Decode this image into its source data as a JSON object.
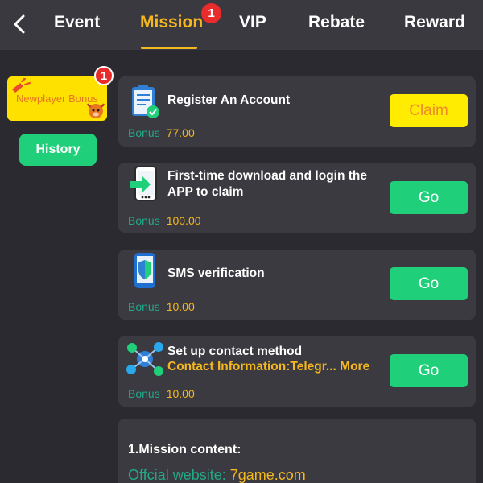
{
  "nav": {
    "tabs": [
      {
        "label": "Event"
      },
      {
        "label": "Mission",
        "badge": "1",
        "active": true
      },
      {
        "label": "VIP"
      },
      {
        "label": "Rebate"
      },
      {
        "label": "Reward"
      }
    ],
    "active_color": "#f5b71f"
  },
  "sidebar": {
    "newplayer_label": "Newplayer Bonus",
    "newplayer_badge": "1",
    "history_label": "History"
  },
  "tasks": [
    {
      "title": "Register An Account",
      "bonus_label": "Bonus",
      "bonus_value": "77.00",
      "action": "Claim",
      "icon": "clipboard-check-icon"
    },
    {
      "title": "First-time download and login the APP to claim",
      "bonus_label": "Bonus",
      "bonus_value": "100.00",
      "action": "Go",
      "icon": "phone-download-icon"
    },
    {
      "title": "SMS verification",
      "bonus_label": "Bonus",
      "bonus_value": "10.00",
      "action": "Go",
      "icon": "phone-shield-icon"
    },
    {
      "title": "Set up contact method",
      "subtitle": "Contact Information:Telegr...",
      "more": "More",
      "bonus_label": "Bonus",
      "bonus_value": "10.00",
      "action": "Go",
      "icon": "social-network-icon"
    }
  ],
  "mission_content": {
    "title": "1.Mission content:",
    "website_label": "Offcial website: ",
    "website_value": "7game.com"
  },
  "colors": {
    "background": "#2b2a30",
    "card": "#3b3a40",
    "green": "#1fcf7a",
    "yellow": "#ffec00",
    "gold": "#f5b71f",
    "teal": "#23a888",
    "badge_red": "#e82b2b"
  }
}
